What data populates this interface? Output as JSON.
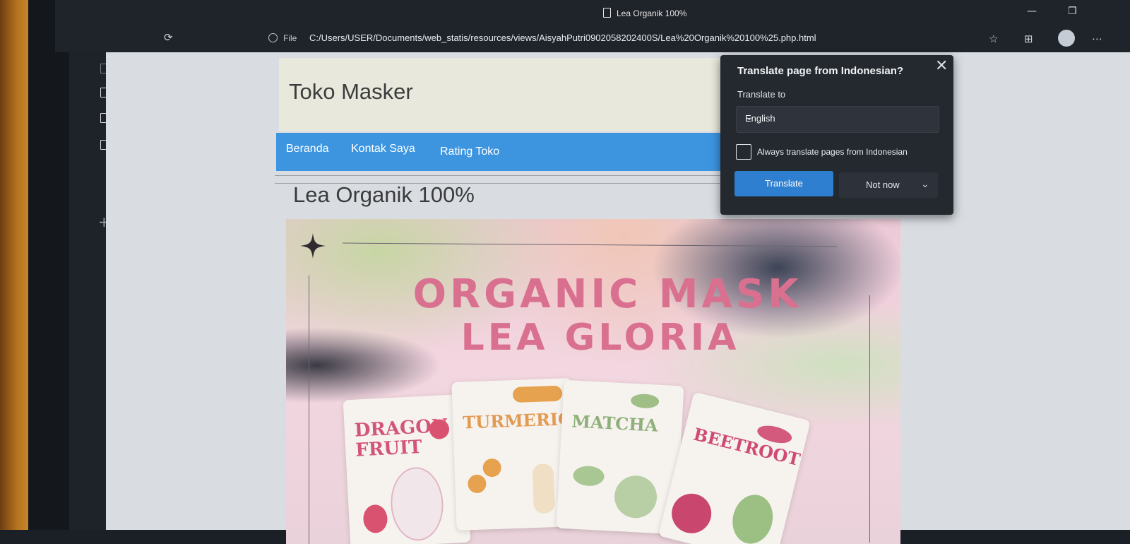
{
  "browser": {
    "window_title": "Lea Organik 100%",
    "file_label": "File",
    "url": "C:/Users/USER/Documents/web_statis/resources/views/AisyahPutri0902058202400S/Lea%20Organik%20100%25.php.html"
  },
  "site": {
    "title": "Toko Masker",
    "nav": [
      "Beranda",
      "Kontak Saya",
      "Rating Toko"
    ],
    "page_heading": "Lea Organik 100%"
  },
  "banner": {
    "line1": "ORGANIC MASK",
    "line2": "LEA GLORIA",
    "packs": [
      "DRAGON FRUIT",
      "TURMERIC",
      "MATCHA",
      "BEETROOT"
    ]
  },
  "translate_popup": {
    "title": "Translate page from Indonesian?",
    "translate_to_label": "Translate to",
    "language": "English",
    "always_label": "Always translate pages from Indonesian",
    "translate_button": "Translate",
    "not_now_button": "Not now"
  },
  "colors": {
    "nav_bar": "#3d95e0",
    "header_bg": "#e8e9dc",
    "banner_text": "#d9708f",
    "translate_button": "#2f7fd1"
  }
}
